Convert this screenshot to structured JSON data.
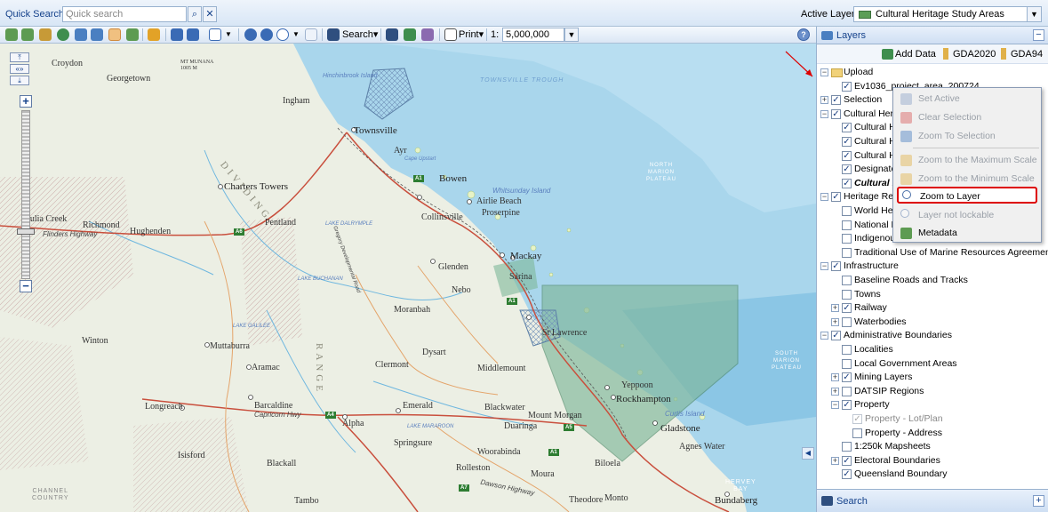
{
  "topbar": {
    "quick_search_label": "Quick Search:",
    "quick_search_placeholder": "Quick search",
    "active_layer_label": "Active Layer:",
    "active_layer_value": "Cultural Heritage Study Areas"
  },
  "toolbar": {
    "search_label": "Search",
    "print_label": "Print",
    "scale_prefix": "1:",
    "scale_value": "5,000,000"
  },
  "map": {
    "places": [
      "Croydon",
      "Georgetown",
      "Ingham",
      "Townsville",
      "Ayr",
      "Bowen",
      "Airlie Beach",
      "Proserpine",
      "Whitsunday Island",
      "Charters Towers",
      "Collinsville",
      "Julia Creek",
      "Richmond",
      "Hughenden",
      "Pentland",
      "Mackay",
      "Glenden",
      "Nebo",
      "Moranbah",
      "Sarina",
      "Winton",
      "Muttaburra",
      "Aramac",
      "Clermont",
      "Dysart",
      "Middlemount",
      "St Lawrence",
      "Yeppoon",
      "Rockhampton",
      "Barcaldine",
      "Emerald",
      "Blackwater",
      "Duaringa",
      "Mount Morgan",
      "Gladstone",
      "Longreach",
      "Alpha",
      "Springsure",
      "Woorabinda",
      "Isisford",
      "Blackall",
      "Rolleston",
      "Moura",
      "Biloela",
      "Agnes Water",
      "Tambo",
      "Theodore",
      "Monto",
      "Bundaberg",
      "Hinchinbrook Island",
      "Curtis Island"
    ],
    "sea_labels": [
      "TOWNSVILLE TROUGH",
      "NORTH\nMARION\nPLATEAU",
      "SOUTH\nMARION\nPLATEAU",
      "CHANNEL\nCOUNTRY",
      "HERVEY\nBAY"
    ],
    "water_labels": [
      "LAKE DALRYMPLE",
      "LAKE BUCHANAN",
      "LAKE GALILEE",
      "LAKE MARAROON",
      "Cape Upstart",
      "Flinders Highway",
      "Capricorn Hwy",
      "Dawson Highway",
      "Gregory Developmental Road"
    ],
    "range_labels": [
      "DIVIDING",
      "RANGE"
    ],
    "mountain": "MT MUNANA\n1005 M",
    "road_shields": [
      "A1",
      "A1",
      "A6",
      "A7",
      "A4",
      "A1",
      "A5"
    ]
  },
  "layers_panel": {
    "title": "Layers",
    "add_data": "Add Data",
    "gda2020": "GDA2020",
    "gda94": "GDA94",
    "search_footer": "Search",
    "rows": [
      {
        "label": "Upload",
        "checked": "",
        "exp": "⊟"
      },
      {
        "label": "Ev1036_project_area_200724",
        "checked": "✓",
        "exp": ""
      },
      {
        "label": "Selection",
        "checked": "✓",
        "exp": "⊞"
      },
      {
        "label": "Cultural Herita",
        "checked": "✓",
        "exp": "⊟"
      },
      {
        "label": "Cultural He",
        "checked": "✓",
        "exp": ""
      },
      {
        "label": "Cultural He",
        "checked": "✓",
        "exp": ""
      },
      {
        "label": "Cultural He",
        "checked": "✓",
        "exp": ""
      },
      {
        "label": "Designated",
        "checked": "✓",
        "exp": ""
      },
      {
        "label": "Cultural H",
        "checked": "✓",
        "exp": ""
      },
      {
        "label": "Heritage Re",
        "checked": "✓",
        "exp": "⊟"
      },
      {
        "label": "World Heri",
        "checked": "",
        "exp": ""
      },
      {
        "label": "National H",
        "checked": "",
        "exp": ""
      },
      {
        "label": "Indigenous",
        "checked": "",
        "exp": ""
      },
      {
        "label": "Traditional Use of Marine Resources Agreement",
        "checked": "",
        "exp": ""
      },
      {
        "label": "Infrastructure",
        "checked": "✓",
        "exp": "⊟"
      },
      {
        "label": "Baseline Roads and Tracks",
        "checked": "",
        "exp": ""
      },
      {
        "label": "Towns",
        "checked": "",
        "exp": ""
      },
      {
        "label": "Railway",
        "checked": "✓",
        "exp": "⊞"
      },
      {
        "label": "Waterbodies",
        "checked": "",
        "exp": "⊞"
      },
      {
        "label": "Administrative Boundaries",
        "checked": "✓",
        "exp": "⊟"
      },
      {
        "label": "Localities",
        "checked": "",
        "exp": ""
      },
      {
        "label": "Local Government Areas",
        "checked": "",
        "exp": ""
      },
      {
        "label": "Mining Layers",
        "checked": "✓",
        "exp": "⊞"
      },
      {
        "label": "DATSIP Regions",
        "checked": "",
        "exp": "⊞"
      },
      {
        "label": "Property",
        "checked": "✓",
        "exp": "⊟"
      },
      {
        "label": "Property - Lot/Plan",
        "checked": "✓",
        "exp": ""
      },
      {
        "label": "Property - Address",
        "checked": "",
        "exp": ""
      },
      {
        "label": "1:250k Mapsheets",
        "checked": "",
        "exp": ""
      },
      {
        "label": "Electoral Boundaries",
        "checked": "✓",
        "exp": "⊞"
      },
      {
        "label": "Queensland Boundary",
        "checked": "✓",
        "exp": ""
      }
    ]
  },
  "context_menu": {
    "items": [
      {
        "label": "Set Active",
        "enabled": false
      },
      {
        "label": "Clear Selection",
        "enabled": false
      },
      {
        "label": "Zoom To Selection",
        "enabled": false
      },
      {
        "label": "Zoom to the Maximum Scale",
        "enabled": false
      },
      {
        "label": "Zoom to the Minimum Scale",
        "enabled": false
      },
      {
        "label": "Zoom to Layer",
        "enabled": true
      },
      {
        "label": "Layer not lockable",
        "enabled": false
      },
      {
        "label": "Metadata",
        "enabled": true
      }
    ]
  },
  "colors": {
    "accent": "#15428b",
    "highlight": "#dd0000",
    "study_area": "#7fb79a",
    "sea": "#9ccfe8"
  }
}
